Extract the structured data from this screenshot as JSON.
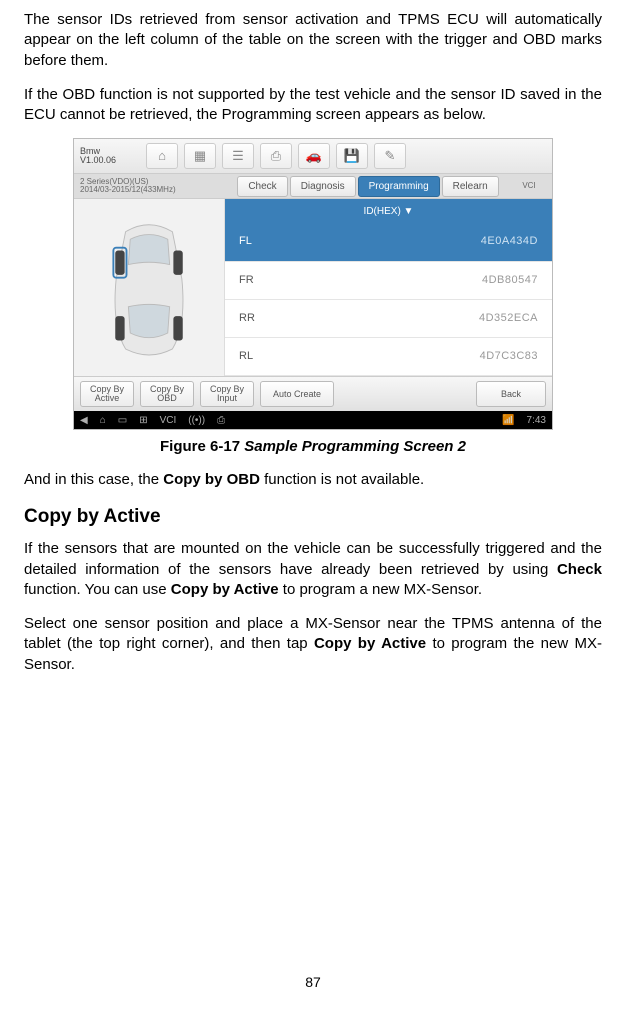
{
  "p1": "The sensor IDs retrieved from sensor activation and TPMS ECU will automatically appear on the left column of the table on the screen with the trigger and OBD marks before them.",
  "p2": "If the OBD function is not supported by the test vehicle and the sensor ID saved in the ECU cannot be retrieved, the Programming screen appears as below.",
  "caption_figno": "Figure 6-17 ",
  "caption_title": "Sample Programming Screen 2",
  "p3_pre": "And in this case, the ",
  "p3_bold": "Copy by OBD",
  "p3_post": " function is not available.",
  "h2": "Copy by Active",
  "p4_a": "If the sensors that are mounted on the vehicle can be successfully triggered and the detailed information of the sensors have already been retrieved by using ",
  "p4_b1": "Check",
  "p4_b": " function. You can use ",
  "p4_b2": "Copy by Active",
  "p4_c": " to program a new MX-Sensor.",
  "p5_a": "Select one sensor position and place a MX-Sensor near the TPMS antenna of the tablet (the top right corner), and then tap ",
  "p5_b1": "Copy by Active",
  "p5_b": " to program the new MX-Sensor.",
  "page_number": "87",
  "shot": {
    "brand_line1": "Bmw",
    "brand_line2": "V1.00.06",
    "vehicle_line1": "2 Series(VDO)(US)",
    "vehicle_line2": "2014/03-2015/12(433MHz)",
    "tabs": [
      "Check",
      "Diagnosis",
      "Programming",
      "Relearn"
    ],
    "tab_selected_index": 2,
    "vci_label": "VCI",
    "id_header": "ID(HEX) ▼",
    "positions": [
      "FL",
      "FR",
      "RR",
      "RL"
    ],
    "ids": [
      "4E0A434D",
      "4DB80547",
      "4D352ECA",
      "4D7C3C83"
    ],
    "selected_row": 0,
    "footer_buttons": [
      "Copy By Active",
      "Copy By OBD",
      "Copy By Input",
      "Auto Create"
    ],
    "back_label": "Back",
    "clock": "7:43"
  }
}
